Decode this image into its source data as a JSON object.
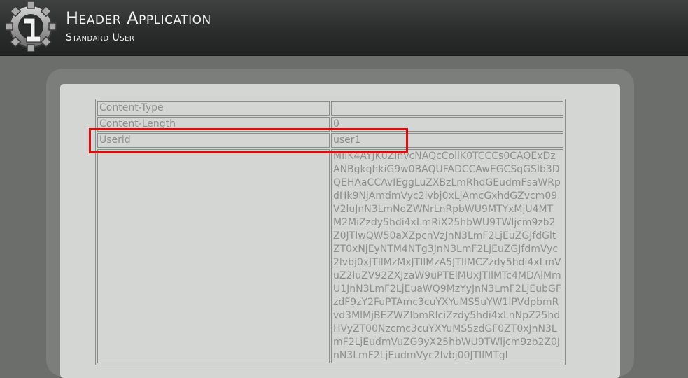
{
  "header": {
    "title": "Header Application",
    "subtitle": "Standard User"
  },
  "rows": [
    {
      "key": "Content-Type",
      "value": ""
    },
    {
      "key": "Content-Length",
      "value": "0"
    },
    {
      "key": "Userid",
      "value": "user1"
    },
    {
      "key": "",
      "value": "MIIK4AYJK0ZIhvcNAQcCollK0TCCCs0CAQExDzANBgkqhkiG9w0BAQUFADCCAwEGCSqGSIb3DQEHAaCCAvIEggLuZXBzLmRhdGEudmFsaWRpdHk9NjAmdmVyc2lvbj0xLjAmcGxhdGZvcm09V2luJnN3LmNoZWNrLnRpbWU9MTYxMjU4MTM2MiZzdy5hdi4xLmRiX25hbWU9TWljcm9zb2Z0JTIwQW50aXZpcnVzJnN3LmF2LjEuZGJfdGltZT0xNjEyNTM4NTg3JnN3LmF2LjEuZGJfdmVyc2lvbj0xJTIlMzMxJTIlMzA5JTIlMCZzdy5hdi4xLmVuZ2luZV92ZXJzaW9uPTElMUxJTIlMTc4MDAlMmU1JnN3LmF2LjEuaWQ9MzYyJnN3LmF2LjEubGFzdF9zY2FuPTAmc3cuYXYuMS5uYW1lPVdpbmRvd3MlMjBEZWZlbmRlciZzdy5hdi4xLnNpZ25hdHVyZT00Nzcmc3cuYXYuMS5zdGF0ZT0xJnN3LmF2LjEudmVuZG9yX25hbWU9TWljcm9zb2Z0JnN3LmF2LjEudmVyc2lvbj00JTIlMTgl"
    }
  ],
  "highlight": {
    "color": "#e20a0a"
  }
}
